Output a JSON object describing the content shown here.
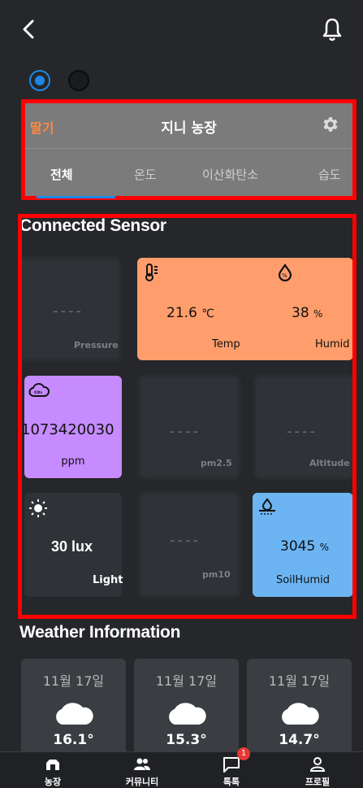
{
  "header": {
    "back_icon": "chevron-left-icon",
    "notification_icon": "bell-icon"
  },
  "farm": {
    "crop": "딸기",
    "name": "지니 농장",
    "settings_icon": "gear-icon",
    "tabs": [
      {
        "label": "전체",
        "active": true
      },
      {
        "label": "온도",
        "active": false
      },
      {
        "label": "이산화탄소",
        "active": false
      },
      {
        "label": "습도",
        "active": false
      }
    ]
  },
  "sensors": {
    "title": "Connected Sensor",
    "pressure": {
      "label": "Pressure",
      "value": "----"
    },
    "temp_humid": {
      "temp_value": "21.6",
      "temp_unit": "℃",
      "temp_label": "Temp",
      "humid_value": "38",
      "humid_unit": "%",
      "humid_label": "Humid"
    },
    "co2": {
      "value": "1073420030",
      "unit": "ppm"
    },
    "pm25": {
      "label": "pm2.5",
      "value": "----"
    },
    "altitude": {
      "label": "Altitude",
      "value": "----"
    },
    "light": {
      "value": "30 lux",
      "label": "Light"
    },
    "pm10": {
      "label": "pm10",
      "value": "----"
    },
    "soil": {
      "value": "3045",
      "unit": "%",
      "label": "SoilHumid"
    }
  },
  "weather": {
    "title": "Weather Information",
    "days": [
      {
        "date": "11월 17일",
        "icon": "cloud-icon",
        "temp": "16.1°"
      },
      {
        "date": "11월 17일",
        "icon": "cloud-icon",
        "temp": "15.3°"
      },
      {
        "date": "11월 17일",
        "icon": "cloud-icon",
        "temp": "14.7°"
      }
    ]
  },
  "nav": {
    "items": [
      {
        "label": "농장",
        "icon": "farm-icon"
      },
      {
        "label": "커뮤니티",
        "icon": "community-icon"
      },
      {
        "label": "톡톡",
        "icon": "chat-icon",
        "badge": "1"
      },
      {
        "label": "프로필",
        "icon": "profile-icon"
      }
    ]
  },
  "colors": {
    "accent": "#1e88e5",
    "highlight_border": "#ff0000",
    "temp_tile": "#ff9e6c",
    "co2_tile": "#c58bff",
    "soil_tile": "#6cb4f2",
    "crop_text": "#ff8a3d"
  }
}
